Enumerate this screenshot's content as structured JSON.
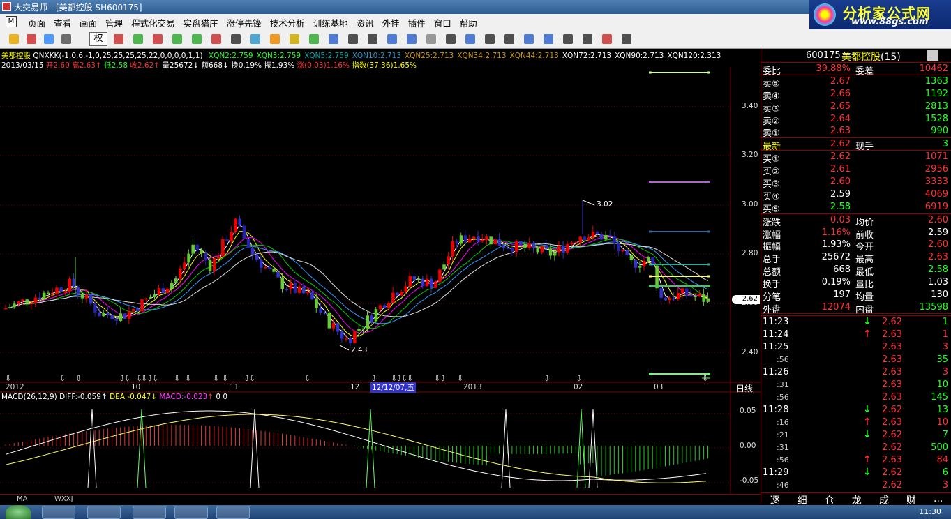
{
  "window": {
    "title": "大交易师 - [美都控股 SH600175]"
  },
  "menu": [
    "页面",
    "查看",
    "画面",
    "管理",
    "程式化交易",
    "实盘猎庄",
    "涨停先锋",
    "技术分析",
    "训练基地",
    "资讯",
    "外挂",
    "插件",
    "窗口",
    "帮助"
  ],
  "logo": {
    "title": "分析家公式网",
    "url": "www.88gs.com"
  },
  "toolbar": {
    "quan_label": "权"
  },
  "indicator_line": {
    "name": "美都控股",
    "formula": "QNXKK(-1,0,6,-1,0,25,25,25,25,22,0,0,0,0,1,1)",
    "items": [
      {
        "label": "XQN2:2.759",
        "color": "#2f2"
      },
      {
        "label": "XQN3:2.759",
        "color": "#2f2"
      },
      {
        "label": "XQN5:2.759",
        "color": "#0aa"
      },
      {
        "label": "XQN10:2.713",
        "color": "#29c"
      },
      {
        "label": "XQN25:2.713",
        "color": "#c90"
      },
      {
        "label": "XQN34:2.713",
        "color": "#c90"
      },
      {
        "label": "XQN44:2.713",
        "color": "#c90"
      },
      {
        "label": "XQN72:2.713",
        "color": "#fff"
      },
      {
        "label": "XQN90:2.713",
        "color": "#fff"
      },
      {
        "label": "XQN120:2.313",
        "color": "#fff"
      }
    ]
  },
  "quote_line": {
    "date": "2013/03/15",
    "open": "开2.60",
    "high": "高2.63",
    "low": "低2.58",
    "close": "收2.62",
    "vol": "量25672",
    "amt": "额668",
    "turnover": "换0.19%",
    "swing": "振1.93%",
    "change": "涨(0.03)1.16%",
    "index": "指数(37.36)1.65%"
  },
  "price_axis": {
    "labels": [
      "3.40",
      "3.20",
      "3.00",
      "2.80",
      "2.60",
      "2.40"
    ],
    "current_tag": "2.62"
  },
  "annotations": {
    "high": "3.02",
    "low": "2.43"
  },
  "date_axis": {
    "labels": [
      "2012",
      "10",
      "11",
      "12",
      "2013",
      "02",
      "03"
    ],
    "cursor": "12/12/07,五",
    "period": "日线"
  },
  "macd": {
    "header": "MACD(26,12,9)",
    "diff": "DIFF:-0.059",
    "dea": "DEA:-0.047",
    "macd": "MACD:-0.023",
    "extra": "0  0",
    "axis": [
      "0.05",
      "0.00",
      "-0.05"
    ]
  },
  "bottom_tabs": [
    "MA",
    "WXXJ"
  ],
  "panel": {
    "code": "600175",
    "name": "美都控股",
    "count": "(15)",
    "weibi": {
      "l": "委比",
      "v": "39.88%",
      "l2": "委差",
      "v2": "10462"
    },
    "asks": [
      {
        "l": "卖⑤",
        "p": "2.67",
        "v": "1363"
      },
      {
        "l": "卖④",
        "p": "2.66",
        "v": "1192"
      },
      {
        "l": "卖③",
        "p": "2.65",
        "v": "2813"
      },
      {
        "l": "卖②",
        "p": "2.64",
        "v": "1528"
      },
      {
        "l": "卖①",
        "p": "2.63",
        "v": "990"
      }
    ],
    "latest": {
      "l": "最新",
      "p": "2.62",
      "l2": "现手",
      "v": "3"
    },
    "bids": [
      {
        "l": "买①",
        "p": "2.62",
        "v": "1071"
      },
      {
        "l": "买②",
        "p": "2.61",
        "v": "2956"
      },
      {
        "l": "买③",
        "p": "2.60",
        "v": "3333"
      },
      {
        "l": "买④",
        "p": "2.59",
        "v": "4069"
      },
      {
        "l": "买⑤",
        "p": "2.58",
        "v": "6919"
      }
    ],
    "stats": [
      {
        "l": "涨跌",
        "v": "0.03",
        "l2": "均价",
        "v2": "2.60",
        "c": "r",
        "c2": "r"
      },
      {
        "l": "涨幅",
        "v": "1.16%",
        "l2": "前收",
        "v2": "2.59",
        "c": "r",
        "c2": "w"
      },
      {
        "l": "振幅",
        "v": "1.93%",
        "l2": "今开",
        "v2": "2.60",
        "c": "w",
        "c2": "r"
      },
      {
        "l": "总手",
        "v": "25672",
        "l2": "最高",
        "v2": "2.63",
        "c": "w",
        "c2": "r"
      },
      {
        "l": "总额",
        "v": "668",
        "l2": "最低",
        "v2": "2.58",
        "c": "w",
        "c2": "g"
      },
      {
        "l": "换手",
        "v": "0.19%",
        "l2": "量比",
        "v2": "1.03",
        "c": "w",
        "c2": "w"
      },
      {
        "l": "分笔",
        "v": "197",
        "l2": "均量",
        "v2": "130",
        "c": "w",
        "c2": "w"
      },
      {
        "l": "外盘",
        "v": "12074",
        "l2": "内盘",
        "v2": "13598",
        "c": "r",
        "c2": "g"
      }
    ],
    "ticks": [
      {
        "t": "11:23",
        "p": "2.62",
        "a": "down",
        "v": "1",
        "pc": "r",
        "vc": "g"
      },
      {
        "t": "11:24",
        "p": "2.63",
        "a": "up",
        "v": "1",
        "pc": "r",
        "vc": "r"
      },
      {
        "t": "11:25",
        "p": "2.63",
        "a": "",
        "v": "3",
        "pc": "r",
        "vc": "r"
      },
      {
        "t": ":56",
        "p": "2.63",
        "a": "",
        "v": "35",
        "pc": "r",
        "vc": "g",
        "small": true
      },
      {
        "t": "11:26",
        "p": "2.63",
        "a": "",
        "v": "3",
        "pc": "r",
        "vc": "r"
      },
      {
        "t": ":31",
        "p": "2.63",
        "a": "",
        "v": "10",
        "pc": "r",
        "vc": "g",
        "small": true
      },
      {
        "t": ":56",
        "p": "2.63",
        "a": "",
        "v": "145",
        "pc": "r",
        "vc": "g",
        "small": true
      },
      {
        "t": "11:28",
        "p": "2.62",
        "a": "down",
        "v": "13",
        "pc": "r",
        "vc": "g"
      },
      {
        "t": ":16",
        "p": "2.63",
        "a": "up",
        "v": "10",
        "pc": "r",
        "vc": "r",
        "small": true
      },
      {
        "t": ":21",
        "p": "2.62",
        "a": "down",
        "v": "7",
        "pc": "r",
        "vc": "g",
        "small": true
      },
      {
        "t": ":31",
        "p": "2.62",
        "a": "",
        "v": "500",
        "pc": "r",
        "vc": "g",
        "small": true
      },
      {
        "t": ":56",
        "p": "2.63",
        "a": "up",
        "v": "84",
        "pc": "r",
        "vc": "r",
        "small": true
      },
      {
        "t": "11:29",
        "p": "2.62",
        "a": "down",
        "v": "6",
        "pc": "r",
        "vc": "g"
      },
      {
        "t": ":46",
        "p": "2.62",
        "a": "",
        "v": "3",
        "pc": "r",
        "vc": "r",
        "small": true
      }
    ],
    "tabs": [
      "逐",
      "细",
      "仓",
      "龙",
      "成",
      "财",
      "..."
    ]
  },
  "taskbar": {
    "clock": "11:30"
  }
}
